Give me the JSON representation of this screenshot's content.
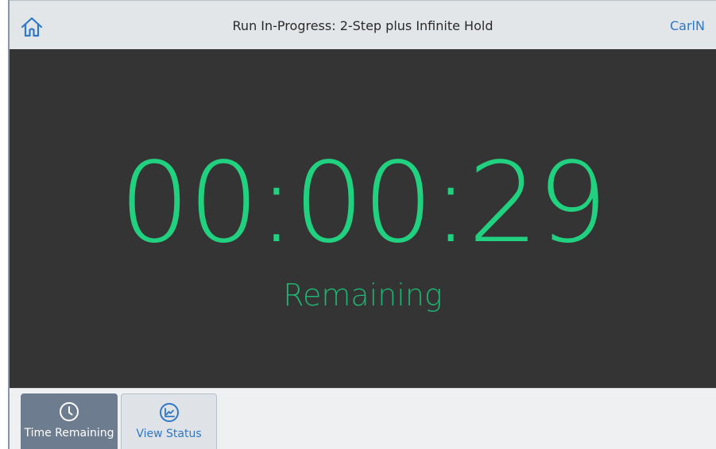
{
  "header": {
    "title": "Run In-Progress: 2-Step plus Infinite Hold",
    "user": "CarlN",
    "home_icon": "home-icon"
  },
  "main": {
    "time_remaining": "00:00:29",
    "remaining_label": "Remaining"
  },
  "footer": {
    "tabs": [
      {
        "label": "Time Remaining",
        "icon": "clock-icon",
        "selected": true
      },
      {
        "label": "View Status",
        "icon": "chart-icon",
        "selected": false
      }
    ]
  },
  "colors": {
    "timer": "#22d17f",
    "main_background": "#343434",
    "accent": "#2f78c5",
    "selected_tab": "#6d7d8f"
  }
}
